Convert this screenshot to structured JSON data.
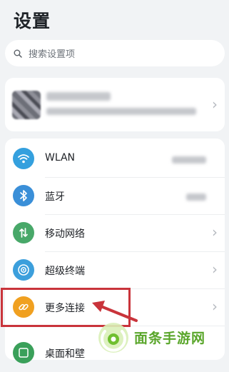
{
  "page": {
    "title": "设置"
  },
  "search": {
    "placeholder": "搜索设置项"
  },
  "settings": {
    "items": [
      {
        "label": "WLAN",
        "icon": "wifi-icon",
        "color": "#34a0de"
      },
      {
        "label": "蓝牙",
        "icon": "bluetooth-icon",
        "color": "#3a8fd8"
      },
      {
        "label": "移动网络",
        "icon": "mobile-network-icon",
        "color": "#48a869"
      },
      {
        "label": "超级终端",
        "icon": "super-device-icon",
        "color": "#3c9fdc"
      },
      {
        "label": "更多连接",
        "icon": "link-icon",
        "color": "#f0a020"
      },
      {
        "label": "桌面和壁",
        "icon": "desktop-wallpaper-icon",
        "color": "#3aa05a"
      }
    ]
  },
  "annotation": {
    "color": "#c9343b"
  },
  "watermark": {
    "text": "面条手游网",
    "color": "#5aa62b"
  }
}
